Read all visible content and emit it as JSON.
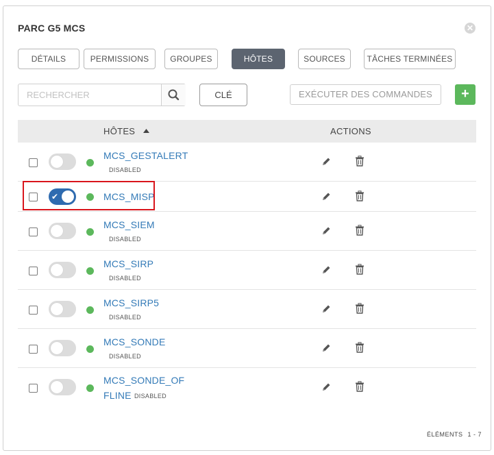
{
  "panel": {
    "title": "PARC G5 MCS"
  },
  "tabs": [
    {
      "label": "DÉTAILS",
      "active": false
    },
    {
      "label": "PERMISSIONS",
      "active": false
    },
    {
      "label": "GROUPES",
      "active": false
    },
    {
      "label": "HÔTES",
      "active": true
    },
    {
      "label": "SOURCES",
      "active": false
    },
    {
      "label": "TÂCHES TERMINÉES",
      "active": false
    }
  ],
  "search": {
    "placeholder": "RECHERCHER",
    "value": ""
  },
  "toolbar": {
    "key_label": "CLÉ",
    "exec_label": "EXÉCUTER DES COMMANDES",
    "add_label": "+"
  },
  "table": {
    "headers": {
      "hosts": "HÔTES",
      "actions": "ACTIONS"
    },
    "rows": [
      {
        "name": "MCS_GESTALERT",
        "name_line2": "",
        "status": "DISABLED",
        "enabled": false
      },
      {
        "name": "MCS_MISP",
        "name_line2": "",
        "status": "",
        "enabled": true
      },
      {
        "name": "MCS_SIEM",
        "name_line2": "",
        "status": "DISABLED",
        "enabled": false
      },
      {
        "name": "MCS_SIRP",
        "name_line2": "",
        "status": "DISABLED",
        "enabled": false
      },
      {
        "name": "MCS_SIRP5",
        "name_line2": "",
        "status": "DISABLED",
        "enabled": false
      },
      {
        "name": "MCS_SONDE",
        "name_line2": "",
        "status": "DISABLED",
        "enabled": false
      },
      {
        "name": "MCS_SONDE_OF",
        "name_line2": "FLINE",
        "status": "DISABLED",
        "enabled": false
      }
    ]
  },
  "pager": {
    "label": "ÉLÉMENTS",
    "range": "1 - 7"
  },
  "colors": {
    "accent_blue": "#337ab7",
    "toggle_on": "#2e6bb0",
    "status_green": "#5cb85c",
    "active_tab": "#5c6470",
    "highlight_red": "#d9141b"
  },
  "icons": {
    "close": "close-icon",
    "search": "search-icon",
    "add": "plus-icon",
    "sort": "sort-up-icon",
    "edit": "pencil-icon",
    "delete": "trash-icon",
    "toggle_check": "check-icon"
  }
}
